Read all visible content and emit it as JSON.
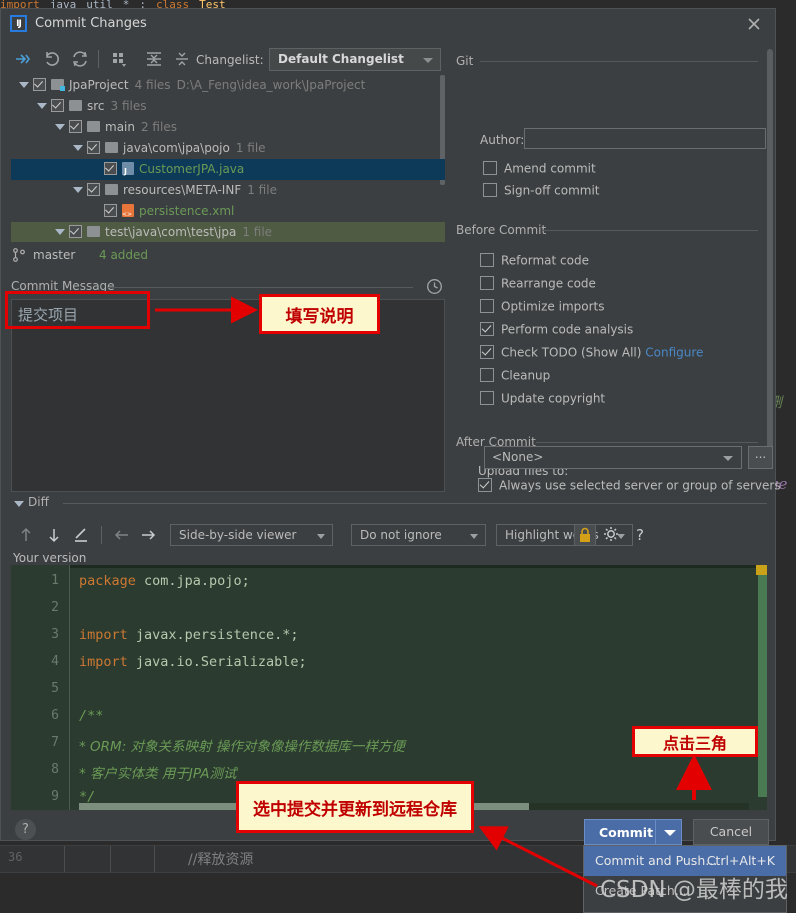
{
  "background": {
    "top_code_fragments": [
      "import",
      "java",
      "util",
      "*",
      ";",
      "class",
      "Test"
    ],
    "right_green_text": "删",
    "right_blue_text": "ge",
    "bottom_line_number": "36",
    "bottom_comment": "//释放资源"
  },
  "dialog": {
    "title": "Commit Changes",
    "app_icon_label": "IJ",
    "close_icon": "close-icon"
  },
  "toolbar": {
    "icons": [
      "show-diff-icon",
      "revert-icon",
      "refresh-icon",
      "group-by-icon",
      "expand-all-icon",
      "collapse-all-icon"
    ],
    "changelist_label": "Changelist:",
    "changelist_value": "Default Changelist"
  },
  "tree": {
    "rows": [
      {
        "indent": 0,
        "triangle": true,
        "checked": true,
        "icon": "folder-module-icon",
        "name": "JpaProject",
        "count": "4 files",
        "path": "D:\\A_Feng\\idea_work\\JpaProject",
        "state": "normal"
      },
      {
        "indent": 1,
        "triangle": true,
        "checked": true,
        "icon": "folder-icon",
        "name": "src",
        "count": "3 files",
        "path": "",
        "state": "normal"
      },
      {
        "indent": 2,
        "triangle": true,
        "checked": true,
        "icon": "folder-icon",
        "name": "main",
        "count": "2 files",
        "path": "",
        "state": "normal"
      },
      {
        "indent": 3,
        "triangle": true,
        "checked": true,
        "icon": "folder-icon",
        "name": "java\\com\\jpa\\pojo",
        "count": "1 file",
        "path": "",
        "state": "normal"
      },
      {
        "indent": 4,
        "triangle": false,
        "checked": true,
        "icon": "java-file-icon",
        "name": "CustomerJPA.java",
        "count": "",
        "path": "",
        "state": "selected"
      },
      {
        "indent": 3,
        "triangle": true,
        "checked": true,
        "icon": "folder-icon",
        "name": "resources\\META-INF",
        "count": "1 file",
        "path": "",
        "state": "normal"
      },
      {
        "indent": 4,
        "triangle": false,
        "checked": true,
        "icon": "xml-file-icon",
        "name": "persistence.xml",
        "count": "",
        "path": "",
        "state": "normal"
      },
      {
        "indent": 2,
        "triangle": true,
        "checked": true,
        "icon": "folder-icon",
        "name": "test\\java\\com\\test\\jpa",
        "count": "1 file",
        "path": "",
        "state": "modified"
      }
    ]
  },
  "branch": {
    "icon": "branch-icon",
    "name": "master",
    "added": "4 added"
  },
  "commit_message": {
    "label": "Commit Message",
    "history_icon": "clock-icon",
    "value": "提交项目"
  },
  "options": {
    "git_group": "Git",
    "author_label": "Author:",
    "author_value": "",
    "amend_commit": {
      "label": "Amend commit",
      "checked": false
    },
    "signoff_commit": {
      "label": "Sign-off commit",
      "checked": false
    },
    "before_commit_group": "Before Commit",
    "before_items": [
      {
        "label": "Reformat code",
        "checked": false
      },
      {
        "label": "Rearrange code",
        "checked": false
      },
      {
        "label": "Optimize imports",
        "checked": false
      },
      {
        "label": "Perform code analysis",
        "checked": true
      },
      {
        "label": "Check TODO (Show All)",
        "checked": true,
        "link": "Configure"
      },
      {
        "label": "Cleanup",
        "checked": false
      },
      {
        "label": "Update copyright",
        "checked": false
      }
    ],
    "after_commit_group": "After Commit",
    "upload_label": "Upload files to:",
    "upload_value": "<None>",
    "upload_more_label": "...",
    "always_use": {
      "label": "Always use selected server or group of servers",
      "checked": true
    }
  },
  "diff": {
    "section_label": "Diff",
    "icons": [
      "prev-change-icon",
      "next-change-icon",
      "annotate-icon",
      "apply-left-icon",
      "apply-right-icon"
    ],
    "viewer_mode": "Side-by-side viewer",
    "ignore_mode": "Do not ignore",
    "highlight_mode": "Highlight words",
    "lock_icon": "lock-icon",
    "settings_icon": "gear-icon",
    "help_icon": "question-icon",
    "version_label": "Your version"
  },
  "code": {
    "lines": [
      {
        "num": "1",
        "tokens": [
          {
            "t": "package",
            "c": "kw"
          },
          {
            "t": " com.jpa.pojo;",
            "c": "pl"
          }
        ]
      },
      {
        "num": "2",
        "tokens": []
      },
      {
        "num": "3",
        "tokens": [
          {
            "t": "import",
            "c": "kw"
          },
          {
            "t": " javax.persistence.*;",
            "c": "pl"
          }
        ]
      },
      {
        "num": "4",
        "tokens": [
          {
            "t": "import",
            "c": "kw"
          },
          {
            "t": " java.io.Serializable;",
            "c": "pl"
          }
        ]
      },
      {
        "num": "5",
        "tokens": []
      },
      {
        "num": "6",
        "tokens": [
          {
            "t": "/**",
            "c": "cm"
          }
        ]
      },
      {
        "num": "7",
        "tokens": [
          {
            "t": " * ORM:  对象关系映射    操作对象像操作数据库一样方便",
            "c": "cm"
          }
        ]
      },
      {
        "num": "8",
        "tokens": [
          {
            "t": " * 客户实体类      用于JPA测试",
            "c": "cm"
          }
        ]
      },
      {
        "num": "9",
        "tokens": [
          {
            "t": " */",
            "c": "cm"
          }
        ]
      }
    ]
  },
  "footer": {
    "help_label": "?",
    "commit_label": "Commit",
    "cancel_label": "Cancel"
  },
  "popup": {
    "items": [
      {
        "label": "Commit and Push...",
        "shortcut": "Ctrl+Alt+K",
        "highlighted": true
      },
      {
        "label": "Create Patch...",
        "shortcut": "",
        "highlighted": false
      }
    ]
  },
  "watermark": {
    "text": "CSDN @最棒的我"
  },
  "annotations": [
    {
      "id": "fill-description",
      "text": "填写说明"
    },
    {
      "id": "select-commit-push",
      "text": "选中提交并更新到远程仓库"
    },
    {
      "id": "click-triangle",
      "text": "点击三角"
    }
  ],
  "colors": {
    "dialog_bg": "#3c3f41",
    "accent_blue": "#4a6da7",
    "selected_row": "#0d3a58",
    "modified_row": "#4f5b43",
    "code_bg": "#2b3b2f",
    "annotation_bg": "#fdf7cd",
    "annotation_border": "#e30000"
  }
}
